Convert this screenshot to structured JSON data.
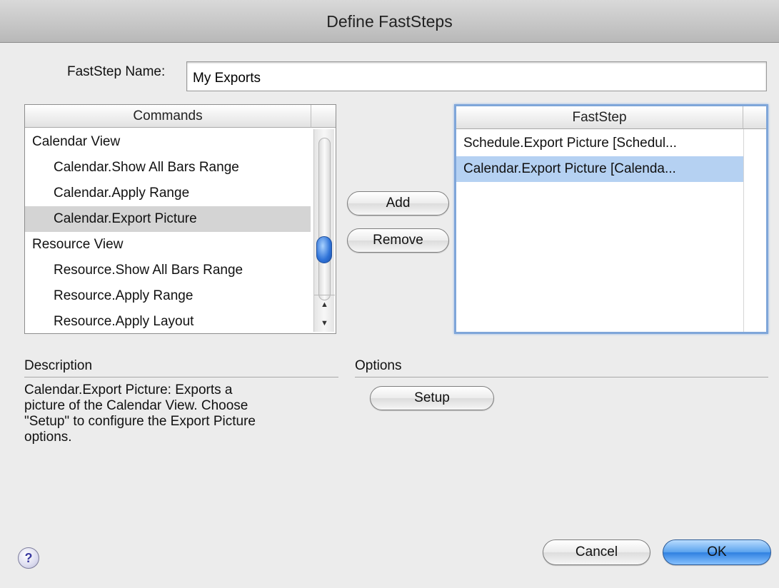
{
  "window": {
    "title": "Define FastSteps"
  },
  "name_field": {
    "label": "FastStep Name:",
    "value": "My Exports"
  },
  "commands": {
    "header": "Commands",
    "items": [
      {
        "label": "Calendar View",
        "level": 0
      },
      {
        "label": "Calendar.Show All Bars Range",
        "level": 1
      },
      {
        "label": "Calendar.Apply Range",
        "level": 1
      },
      {
        "label": "Calendar.Export Picture",
        "level": 1,
        "selected": true
      },
      {
        "label": "Resource View",
        "level": 0
      },
      {
        "label": "Resource.Show All Bars Range",
        "level": 1
      },
      {
        "label": "Resource.Apply Range",
        "level": 1
      },
      {
        "label": "Resource.Apply Layout",
        "level": 1
      }
    ],
    "scroll_up_icon": "scroll-up-arrow",
    "scroll_down_icon": "scroll-down-arrow"
  },
  "faststep": {
    "header": "FastStep",
    "items": [
      {
        "label": "Schedule.Export Picture [Schedul..."
      },
      {
        "label": "Calendar.Export Picture [Calenda...",
        "selected": true
      }
    ]
  },
  "buttons": {
    "add": "Add",
    "remove": "Remove",
    "setup": "Setup",
    "cancel": "Cancel",
    "ok": "OK"
  },
  "description": {
    "label": "Description",
    "text": "Calendar.Export Picture: Exports a\npicture of the Calendar View.  Choose\n\"Setup\" to configure the Export Picture\noptions."
  },
  "options": {
    "label": "Options"
  },
  "help": {
    "icon": "help-icon",
    "glyph": "?"
  },
  "colors": {
    "selection_blue": "#b5d1f2",
    "selection_gray": "#d4d4d4",
    "default_button": "#3f8ee6"
  }
}
